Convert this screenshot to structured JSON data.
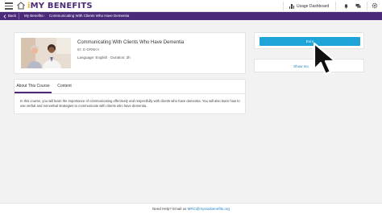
{
  "header": {
    "logo_text": "MY BENEFITS",
    "logo_letter": "i",
    "usage_dashboard_label": "Usage Dashboard"
  },
  "breadcrumb": {
    "back_label": "Back",
    "items": [
      "My Benefits",
      "Communicating With Clients Who Have Dementia"
    ]
  },
  "course": {
    "title": "Communicating With Clients Who Have Dementia",
    "id_line": "ID: E-DRNKV",
    "meta_line": "Language: English · Duration: 2h"
  },
  "tabs": [
    {
      "label": "About This Course",
      "active": true
    },
    {
      "label": "Content",
      "active": false
    }
  ],
  "description": "In this course, you will learn the importance of communicating effectively and respectfully with clients who have dementia. You will also learn how to use verbal and nonverbal strategies to communicate with clients who have dementia.",
  "actions": {
    "enroll_label": "Enro",
    "show_more_label": "Show mo"
  },
  "footer": {
    "prefix": "Need Help? Email us ",
    "email": "MRC@myssiobenefits.org"
  },
  "colors": {
    "brand_purple": "#4b2a7a",
    "accent_blue": "#1ea4d6",
    "logo_yellow": "#f5b81c"
  },
  "icons": [
    "hamburger-menu-icon",
    "home-icon",
    "bar-chart-icon",
    "bell-icon",
    "chat-icon",
    "gear-icon",
    "chevron-left-icon",
    "mouse-cursor-icon"
  ]
}
